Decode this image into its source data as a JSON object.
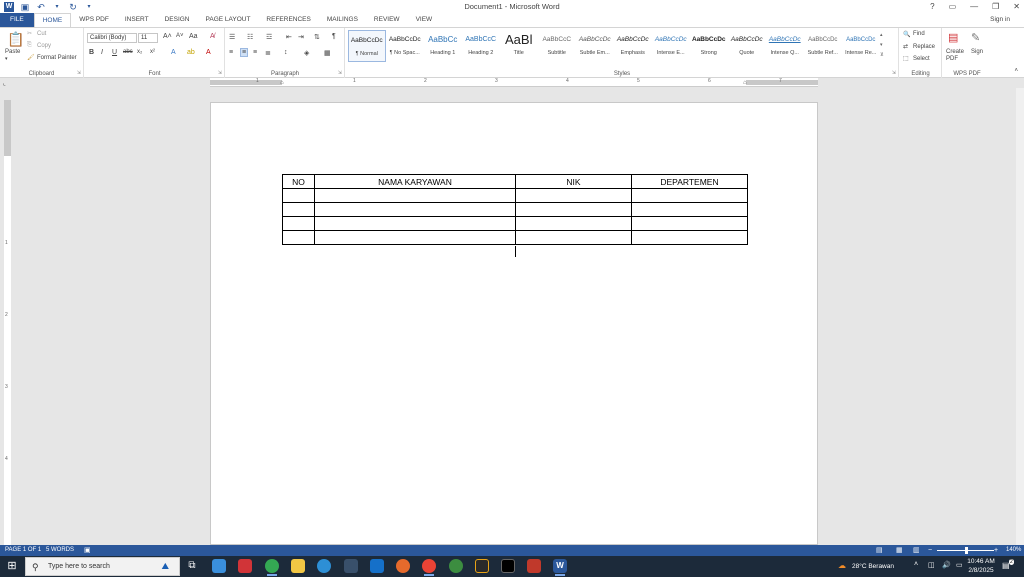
{
  "window": {
    "title": "Document1 - Microsoft Word",
    "controls": [
      "?",
      "▭",
      "—",
      "❐",
      "✕"
    ]
  },
  "tabs": [
    {
      "label": "FILE"
    },
    {
      "label": "HOME"
    },
    {
      "label": "WPS PDF"
    },
    {
      "label": "INSERT"
    },
    {
      "label": "DESIGN"
    },
    {
      "label": "PAGE LAYOUT"
    },
    {
      "label": "REFERENCES"
    },
    {
      "label": "MAILINGS"
    },
    {
      "label": "REVIEW"
    },
    {
      "label": "VIEW"
    }
  ],
  "sign_in": "Sign in",
  "clipboard": {
    "paste": "Paste",
    "cut": "Cut",
    "copy": "Copy",
    "format_painter": "Format Painter",
    "label": "Clipboard"
  },
  "font": {
    "name": "Calibri (Body)",
    "size": "11",
    "label": "Font"
  },
  "paragraph": {
    "label": "Paragraph"
  },
  "styles": {
    "label": "Styles",
    "items": [
      {
        "sample": "AaBbCcDc",
        "name": "¶ Normal"
      },
      {
        "sample": "AaBbCcDc",
        "name": "¶ No Spac..."
      },
      {
        "sample": "AaBbCc",
        "name": "Heading 1"
      },
      {
        "sample": "AaBbCcC",
        "name": "Heading 2"
      },
      {
        "sample": "AaBl",
        "name": "Title"
      },
      {
        "sample": "AaBbCcC",
        "name": "Subtitle"
      },
      {
        "sample": "AaBbCcDc",
        "name": "Subtle Em..."
      },
      {
        "sample": "AaBbCcDc",
        "name": "Emphasis"
      },
      {
        "sample": "AaBbCcDc",
        "name": "Intense E..."
      },
      {
        "sample": "AaBbCcDc",
        "name": "Strong"
      },
      {
        "sample": "AaBbCcDc",
        "name": "Quote"
      },
      {
        "sample": "AaBbCcDc",
        "name": "Intense Q..."
      },
      {
        "sample": "AaBbCcDc",
        "name": "Subtle Ref..."
      },
      {
        "sample": "AaBbCcDc",
        "name": "Intense Re..."
      }
    ]
  },
  "editing": {
    "find": "Find",
    "replace": "Replace",
    "select": "Select",
    "label": "Editing"
  },
  "wps": {
    "create_pdf": "Create PDF",
    "sign": "Sign",
    "label": "WPS PDF"
  },
  "ruler": {
    "h_numbers": [
      "1",
      "1",
      "2",
      "3",
      "4",
      "5",
      "6",
      "7"
    ],
    "v_numbers": [
      "1",
      "2",
      "3",
      "4"
    ]
  },
  "table": {
    "headers": [
      "NO",
      "NAMA KARYAWAN",
      "NIK",
      "DEPARTEMEN"
    ],
    "empty_rows": 4
  },
  "status": {
    "page": "PAGE 1 OF 1",
    "words": "5 WORDS",
    "zoom": "140%"
  },
  "taskbar": {
    "search_placeholder": "Type here to search",
    "weather": "28°C  Berawan",
    "time": "10:46 AM",
    "date": "2/8/2025",
    "notifications": "2"
  },
  "colors": {
    "accent": "#2b579a",
    "taskbar": "#1c2a3a"
  }
}
